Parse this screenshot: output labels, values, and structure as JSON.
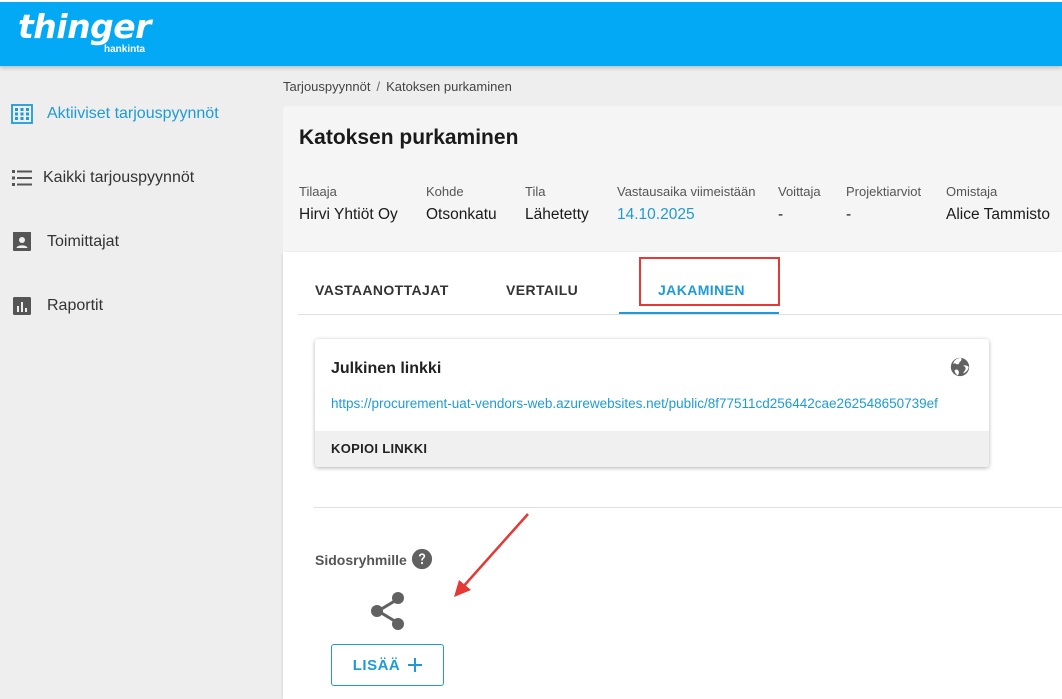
{
  "header": {
    "logo_text": "thinger",
    "logo_sub": "hankinta",
    "bg_color": "#03a9f4"
  },
  "sidebar": {
    "items": [
      {
        "label": "Aktiiviset tarjouspyynnöt",
        "icon": "grid-icon",
        "active": true
      },
      {
        "label": "Kaikki tarjouspyynnöt",
        "icon": "list-icon",
        "active": false
      },
      {
        "label": "Toimittajat",
        "icon": "contact-card-icon",
        "active": false
      },
      {
        "label": "Raportit",
        "icon": "bar-chart-icon",
        "active": false
      }
    ]
  },
  "breadcrumb": {
    "root": "Tarjouspyynnöt",
    "separator": "/",
    "current": "Katoksen purkaminen"
  },
  "request": {
    "title": "Katoksen purkaminen",
    "fields": [
      {
        "label": "Tilaaja",
        "value": "Hirvi Yhtiöt Oy"
      },
      {
        "label": "Kohde",
        "value": "Otsonkatu"
      },
      {
        "label": "Tila",
        "value": "Lähetetty"
      },
      {
        "label": "Vastausaika viimeistään",
        "value": "14.10.2025"
      },
      {
        "label": "Voittaja",
        "value": "-"
      },
      {
        "label": "Projektiarviot",
        "value": "-"
      },
      {
        "label": "Omistaja",
        "value": "Alice Tammisto"
      }
    ]
  },
  "tabs": [
    {
      "label": "VASTAANOTTAJAT",
      "active": false
    },
    {
      "label": "VERTAILU",
      "active": false
    },
    {
      "label": "JAKAMINEN",
      "active": true
    }
  ],
  "public_link": {
    "title": "Julkinen linkki",
    "url": "https://procurement-uat-vendors-web.azurewebsites.net/public/8f77511cd256442cae262548650739ef",
    "copy_label": "KOPIOI LINKKI"
  },
  "stakeholders": {
    "label": "Sidosryhmille",
    "add_label": "LISÄÄ"
  },
  "colors": {
    "accent": "#1e9bd7",
    "annotation": "#e53935"
  }
}
